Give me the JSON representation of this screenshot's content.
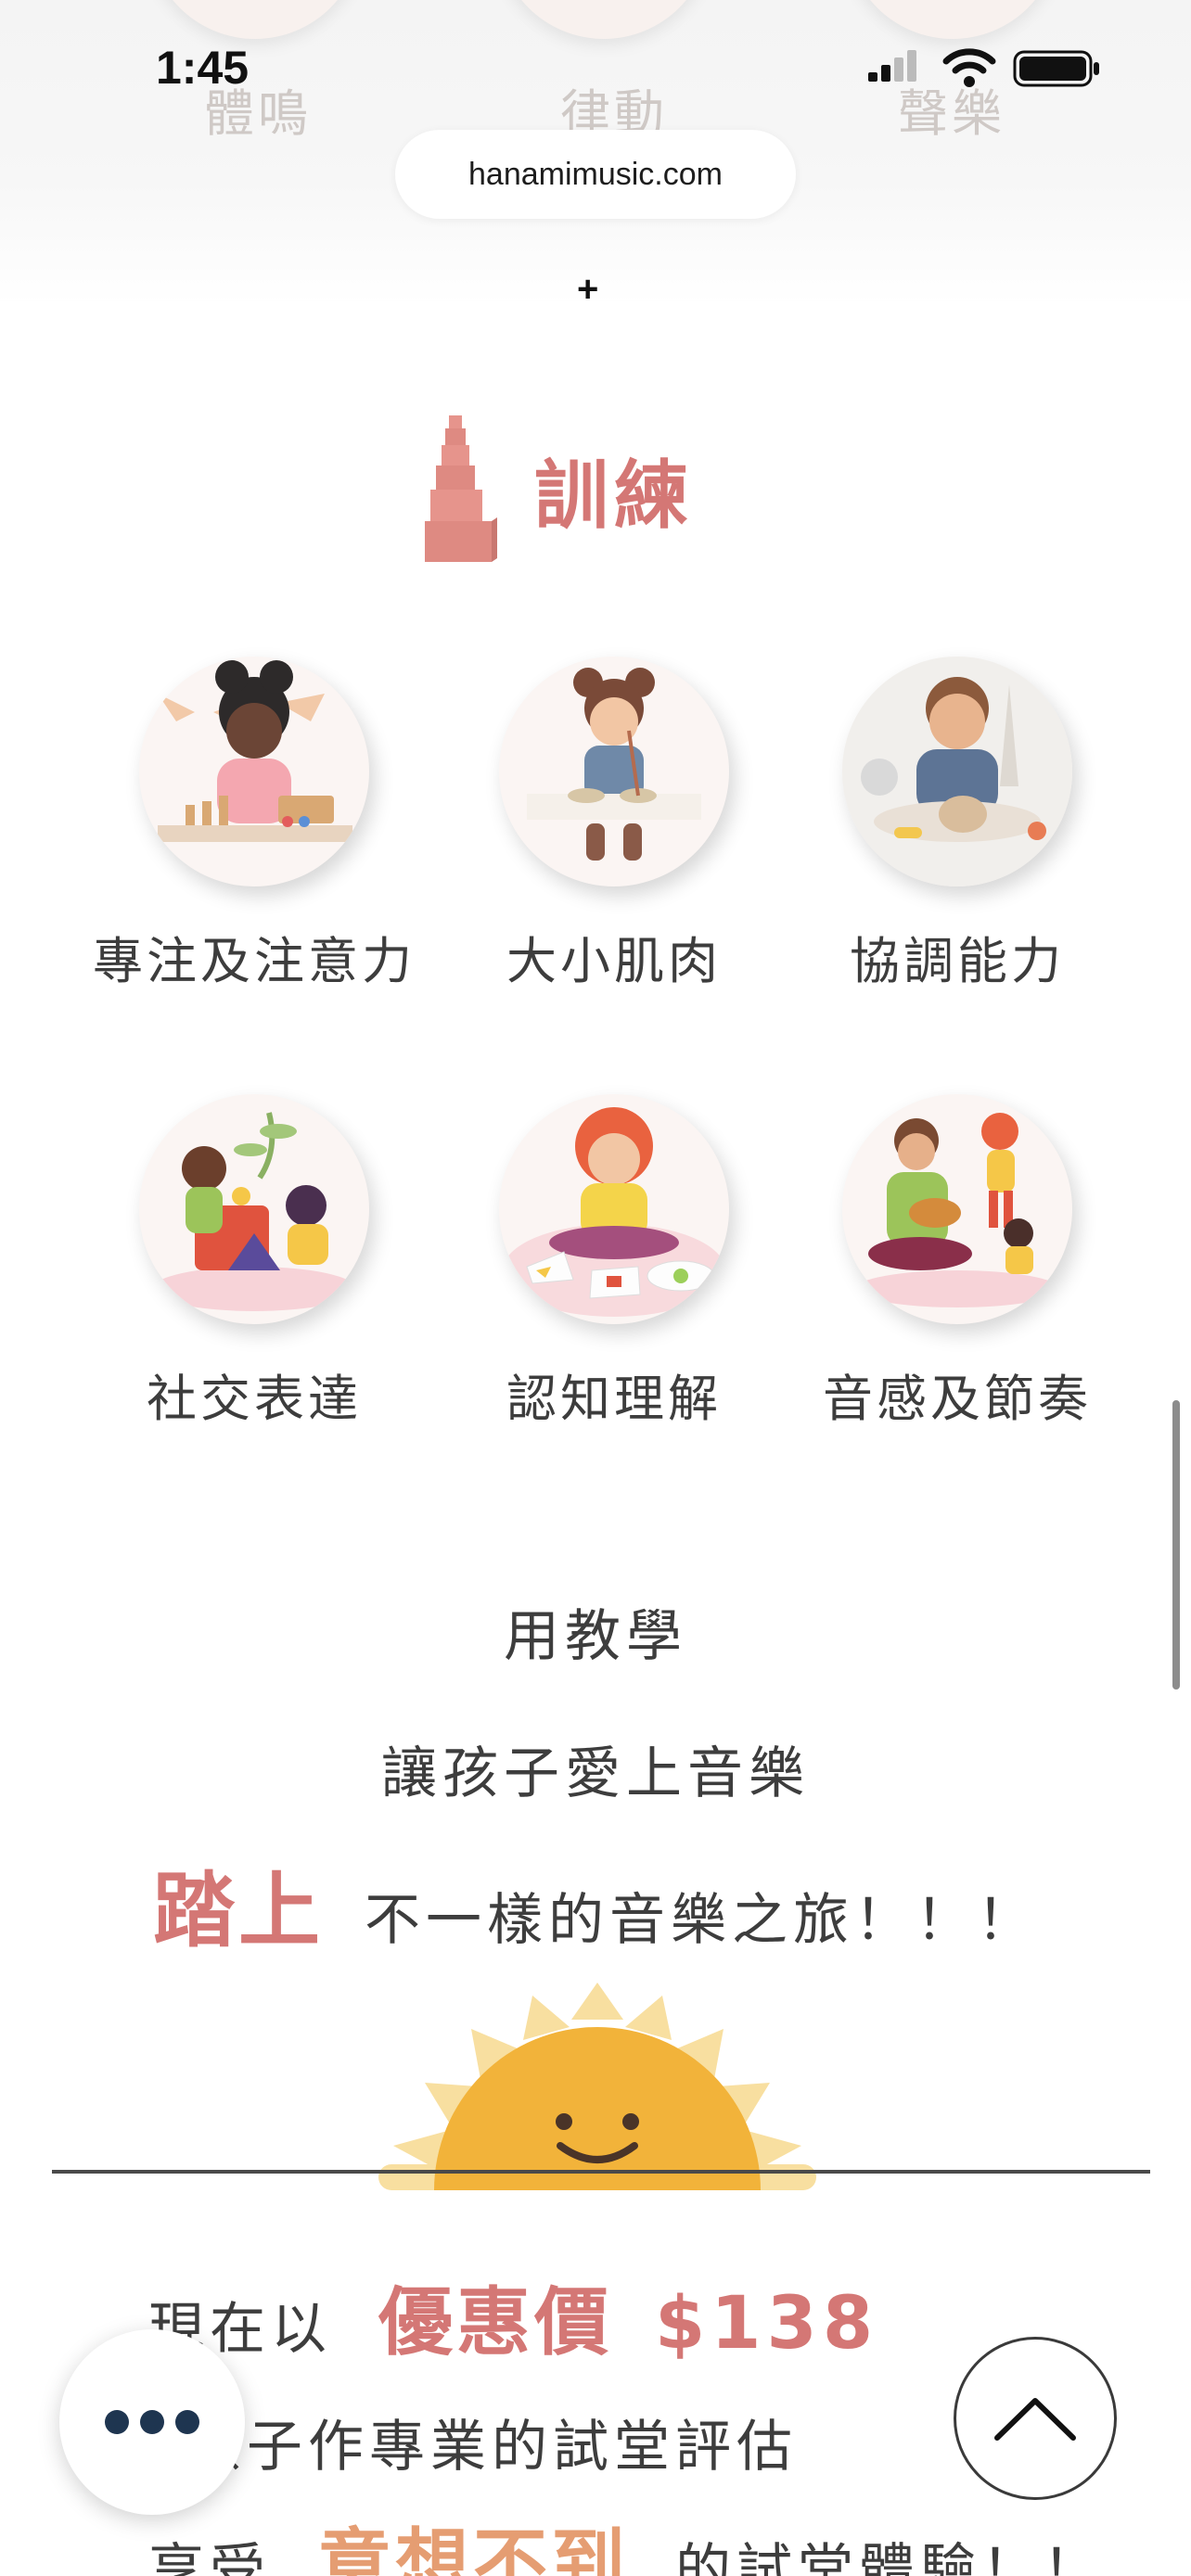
{
  "status_bar": {
    "time": "1:45"
  },
  "browser": {
    "url": "hanamimusic.com"
  },
  "previous_section": {
    "labels": [
      "體鳴",
      "律動",
      "聲樂"
    ],
    "plus_glyph": "+"
  },
  "training": {
    "title": "訓練",
    "skills": [
      {
        "label": "專注及注意力"
      },
      {
        "label": "大小肌肉"
      },
      {
        "label": "協調能力"
      },
      {
        "label": "社交表達"
      },
      {
        "label": "認知理解"
      },
      {
        "label": "音感及節奏"
      }
    ]
  },
  "slogan": {
    "line1": "用教學",
    "line2": "讓孩子愛上音樂",
    "line3_accent": "踏上",
    "line3_rest": "不一樣的音樂之旅！！！"
  },
  "offer": {
    "line1_prefix": "現在以",
    "line1_accent": "優惠價",
    "line1_price": "$138",
    "line2": "孩子作專業的試堂評估",
    "line3_prefix": "享受",
    "line3_accent": "意想不到",
    "line3_suffix": "的試堂體驗！！"
  },
  "colors": {
    "accent_pink": "#d47775",
    "accent_orange": "#e59d72",
    "sun_yellow": "#f2b33a",
    "sun_rays": "#f8dfa0",
    "fab_dots": "#1e3550"
  },
  "icons": {
    "menu_button": "more-dots-icon",
    "scroll_top_button": "chevron-up-icon",
    "section_icon": "pink-tower-icon"
  }
}
